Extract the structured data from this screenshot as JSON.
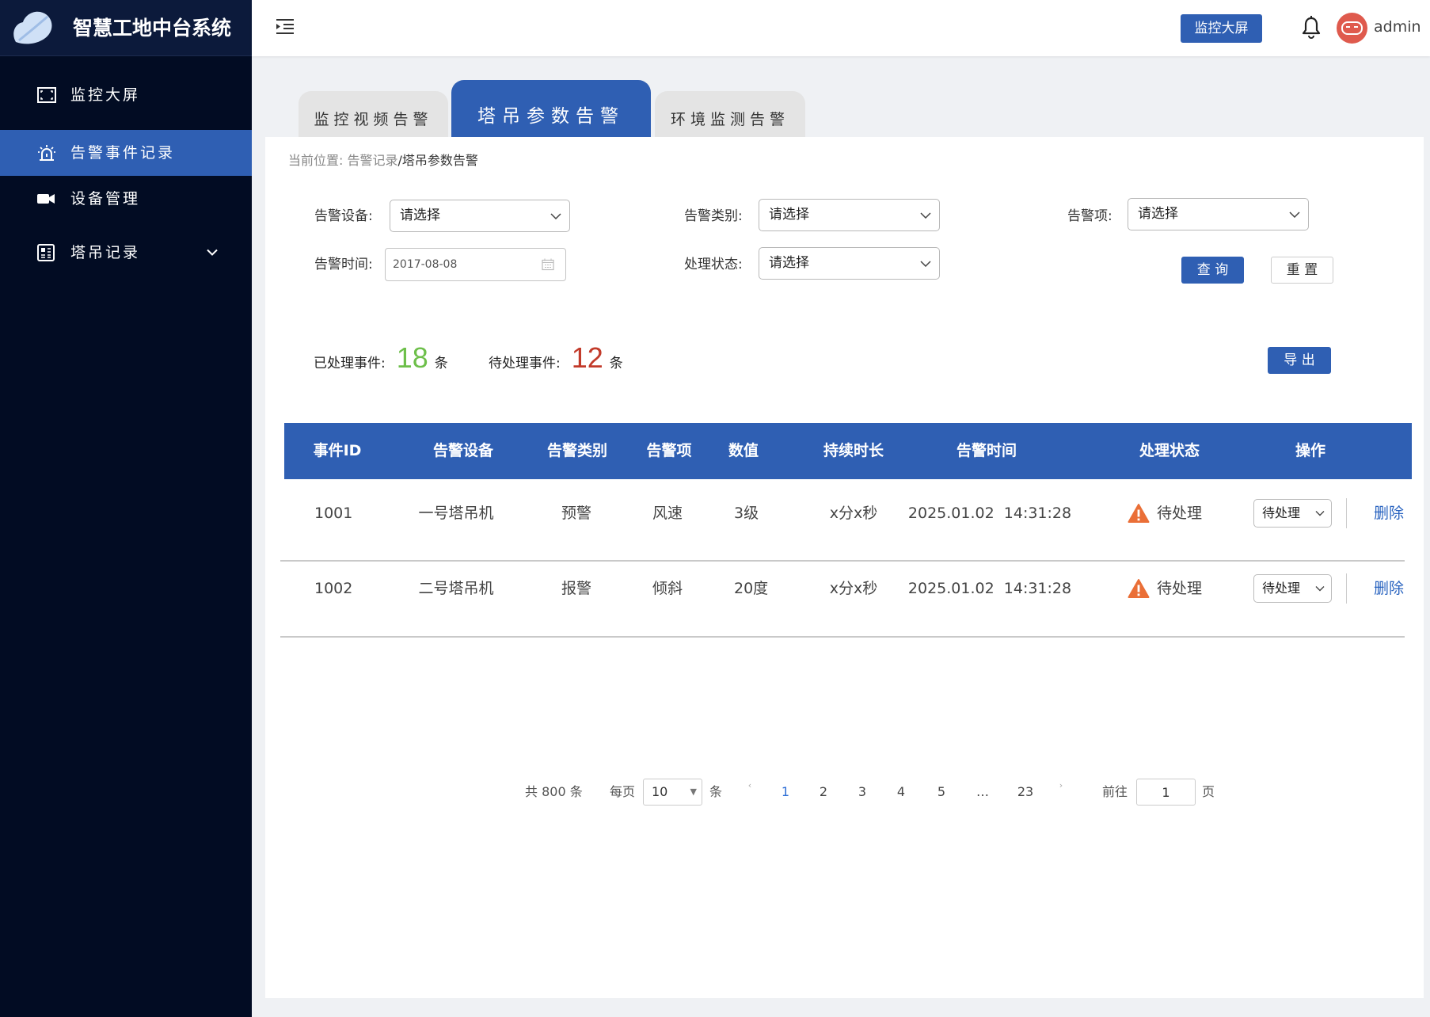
{
  "app": {
    "title": "智慧工地中台系统",
    "logo_icon": "cloud-logo-icon"
  },
  "colors": {
    "primary": "#2f5fb3",
    "sidebar_bg": "#020c23",
    "logo_bg": "#0c1a3b",
    "processed": "#6dbf4a",
    "pending": "#c23a2a",
    "warning": "#ea6f37",
    "avatar": "#df5a4d",
    "link": "#2a64c0",
    "page_active": "#2f6fd6"
  },
  "sidebar": {
    "items": [
      {
        "label": "监控大屏",
        "icon": "monitor-icon",
        "active": false
      },
      {
        "label": "告警事件记录",
        "icon": "alarm-icon",
        "active": true
      },
      {
        "label": "设备管理",
        "icon": "video-camera-icon",
        "active": false
      },
      {
        "label": "塔吊记录",
        "icon": "crane-record-icon",
        "active": false,
        "expand_icon": "chevron-down-icon"
      }
    ]
  },
  "header": {
    "menu_icon": "menu-fold-icon",
    "monitor_button": "监控大屏",
    "bell_icon": "bell-icon",
    "avatar_icon": "robot-avatar-icon",
    "username": "admin"
  },
  "tabs": [
    {
      "label": "监控视频告警",
      "active": false
    },
    {
      "label": "塔吊参数告警",
      "active": true
    },
    {
      "label": "环境监测告警",
      "active": false
    }
  ],
  "breadcrumb": {
    "prefix": "当前位置:",
    "parent": "告警记录",
    "separator": "/",
    "current": "塔吊参数告警"
  },
  "filters": {
    "device": {
      "label": "告警设备:",
      "placeholder": "请选择"
    },
    "category": {
      "label": "告警类别:",
      "placeholder": "请选择"
    },
    "item": {
      "label": "告警项:",
      "placeholder": "请选择"
    },
    "time": {
      "label": "告警时间:",
      "value": "2017-08-08",
      "icon": "calendar-icon"
    },
    "status": {
      "label": "处理状态:",
      "placeholder": "请选择"
    },
    "query_button": "查 询",
    "reset_button": "重 置"
  },
  "stats": {
    "processed_label": "已处理事件:",
    "processed_count": "18",
    "pending_label": "待处理事件:",
    "pending_count": "12",
    "unit": "条",
    "export_button": "导 出"
  },
  "table": {
    "columns": [
      "事件ID",
      "告警设备",
      "告警类别",
      "告警项",
      "数值",
      "持续时长",
      "告警时间",
      "处理状态",
      "操作"
    ],
    "rows": [
      {
        "id": "1001",
        "device": "一号塔吊机",
        "category": "预警",
        "item": "风速",
        "value": "3级",
        "duration": "x分x秒",
        "time": "2025.01.02  14:31:28",
        "status": "待处理",
        "status_icon": "warning-icon",
        "status_select": "待处理",
        "action": "删除"
      },
      {
        "id": "1002",
        "device": "二号塔吊机",
        "category": "报警",
        "item": "倾斜",
        "value": "20度",
        "duration": "x分x秒",
        "time": "2025.01.02  14:31:28",
        "status": "待处理",
        "status_icon": "warning-icon",
        "status_select": "待处理",
        "action": "删除"
      }
    ]
  },
  "pagination": {
    "total": "共 800 条",
    "per_page_label": "每页",
    "page_size": "10",
    "per_page_unit": "条",
    "prev": "‹",
    "pages": [
      "1",
      "2",
      "3",
      "4",
      "5",
      "…",
      "23"
    ],
    "current": "1",
    "next": "›",
    "goto_label": "前往",
    "goto_value": "1",
    "page_unit": "页"
  }
}
